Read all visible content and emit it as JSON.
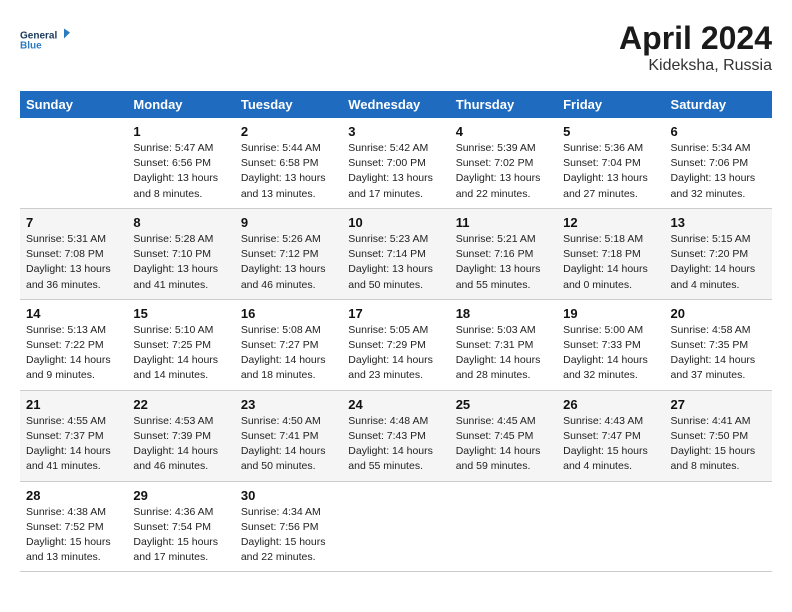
{
  "logo": {
    "line1": "General",
    "line2": "Blue"
  },
  "title": "April 2024",
  "subtitle": "Kideksha, Russia",
  "days_of_week": [
    "Sunday",
    "Monday",
    "Tuesday",
    "Wednesday",
    "Thursday",
    "Friday",
    "Saturday"
  ],
  "weeks": [
    [
      null,
      {
        "day": "1",
        "sunrise": "5:47 AM",
        "sunset": "6:56 PM",
        "daylight": "13 hours and 8 minutes."
      },
      {
        "day": "2",
        "sunrise": "5:44 AM",
        "sunset": "6:58 PM",
        "daylight": "13 hours and 13 minutes."
      },
      {
        "day": "3",
        "sunrise": "5:42 AM",
        "sunset": "7:00 PM",
        "daylight": "13 hours and 17 minutes."
      },
      {
        "day": "4",
        "sunrise": "5:39 AM",
        "sunset": "7:02 PM",
        "daylight": "13 hours and 22 minutes."
      },
      {
        "day": "5",
        "sunrise": "5:36 AM",
        "sunset": "7:04 PM",
        "daylight": "13 hours and 27 minutes."
      },
      {
        "day": "6",
        "sunrise": "5:34 AM",
        "sunset": "7:06 PM",
        "daylight": "13 hours and 32 minutes."
      }
    ],
    [
      {
        "day": "7",
        "sunrise": "5:31 AM",
        "sunset": "7:08 PM",
        "daylight": "13 hours and 36 minutes."
      },
      {
        "day": "8",
        "sunrise": "5:28 AM",
        "sunset": "7:10 PM",
        "daylight": "13 hours and 41 minutes."
      },
      {
        "day": "9",
        "sunrise": "5:26 AM",
        "sunset": "7:12 PM",
        "daylight": "13 hours and 46 minutes."
      },
      {
        "day": "10",
        "sunrise": "5:23 AM",
        "sunset": "7:14 PM",
        "daylight": "13 hours and 50 minutes."
      },
      {
        "day": "11",
        "sunrise": "5:21 AM",
        "sunset": "7:16 PM",
        "daylight": "13 hours and 55 minutes."
      },
      {
        "day": "12",
        "sunrise": "5:18 AM",
        "sunset": "7:18 PM",
        "daylight": "14 hours and 0 minutes."
      },
      {
        "day": "13",
        "sunrise": "5:15 AM",
        "sunset": "7:20 PM",
        "daylight": "14 hours and 4 minutes."
      }
    ],
    [
      {
        "day": "14",
        "sunrise": "5:13 AM",
        "sunset": "7:22 PM",
        "daylight": "14 hours and 9 minutes."
      },
      {
        "day": "15",
        "sunrise": "5:10 AM",
        "sunset": "7:25 PM",
        "daylight": "14 hours and 14 minutes."
      },
      {
        "day": "16",
        "sunrise": "5:08 AM",
        "sunset": "7:27 PM",
        "daylight": "14 hours and 18 minutes."
      },
      {
        "day": "17",
        "sunrise": "5:05 AM",
        "sunset": "7:29 PM",
        "daylight": "14 hours and 23 minutes."
      },
      {
        "day": "18",
        "sunrise": "5:03 AM",
        "sunset": "7:31 PM",
        "daylight": "14 hours and 28 minutes."
      },
      {
        "day": "19",
        "sunrise": "5:00 AM",
        "sunset": "7:33 PM",
        "daylight": "14 hours and 32 minutes."
      },
      {
        "day": "20",
        "sunrise": "4:58 AM",
        "sunset": "7:35 PM",
        "daylight": "14 hours and 37 minutes."
      }
    ],
    [
      {
        "day": "21",
        "sunrise": "4:55 AM",
        "sunset": "7:37 PM",
        "daylight": "14 hours and 41 minutes."
      },
      {
        "day": "22",
        "sunrise": "4:53 AM",
        "sunset": "7:39 PM",
        "daylight": "14 hours and 46 minutes."
      },
      {
        "day": "23",
        "sunrise": "4:50 AM",
        "sunset": "7:41 PM",
        "daylight": "14 hours and 50 minutes."
      },
      {
        "day": "24",
        "sunrise": "4:48 AM",
        "sunset": "7:43 PM",
        "daylight": "14 hours and 55 minutes."
      },
      {
        "day": "25",
        "sunrise": "4:45 AM",
        "sunset": "7:45 PM",
        "daylight": "14 hours and 59 minutes."
      },
      {
        "day": "26",
        "sunrise": "4:43 AM",
        "sunset": "7:47 PM",
        "daylight": "15 hours and 4 minutes."
      },
      {
        "day": "27",
        "sunrise": "4:41 AM",
        "sunset": "7:50 PM",
        "daylight": "15 hours and 8 minutes."
      }
    ],
    [
      {
        "day": "28",
        "sunrise": "4:38 AM",
        "sunset": "7:52 PM",
        "daylight": "15 hours and 13 minutes."
      },
      {
        "day": "29",
        "sunrise": "4:36 AM",
        "sunset": "7:54 PM",
        "daylight": "15 hours and 17 minutes."
      },
      {
        "day": "30",
        "sunrise": "4:34 AM",
        "sunset": "7:56 PM",
        "daylight": "15 hours and 22 minutes."
      },
      null,
      null,
      null,
      null
    ]
  ]
}
